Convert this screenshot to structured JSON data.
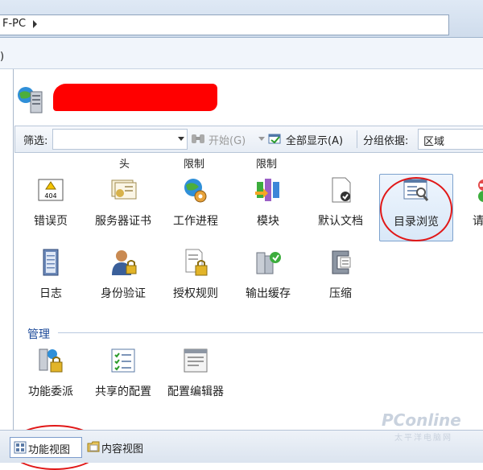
{
  "address_bar": {
    "path_text": "F-PC"
  },
  "menu": {
    "partial_text": ")"
  },
  "filter_toolbar": {
    "filter_label": "筛选:",
    "start_label": "开始(G)",
    "show_all_label": "全部显示(A)",
    "group_by_label": "分组依据:",
    "group_by_value": "区域"
  },
  "column_headers": [
    "头",
    "限制",
    "限制"
  ],
  "features_row1": [
    {
      "label": "错误页",
      "icon": "error-404-icon"
    },
    {
      "label": "服务器证书",
      "icon": "certificate-icon"
    },
    {
      "label": "工作进程",
      "icon": "worker-process-icon"
    },
    {
      "label": "模块",
      "icon": "modules-icon"
    },
    {
      "label": "默认文档",
      "icon": "default-document-icon"
    },
    {
      "label": "目录浏览",
      "icon": "directory-browsing-icon"
    },
    {
      "label": "请求",
      "icon": "request-filtering-icon"
    }
  ],
  "features_row2": [
    {
      "label": "日志",
      "icon": "logging-icon"
    },
    {
      "label": "身份验证",
      "icon": "authentication-icon"
    },
    {
      "label": "授权规则",
      "icon": "authorization-icon"
    },
    {
      "label": "输出缓存",
      "icon": "output-cache-icon"
    },
    {
      "label": "压缩",
      "icon": "compression-icon"
    }
  ],
  "management_group": {
    "title": "管理",
    "items": [
      {
        "label": "功能委派",
        "icon": "feature-delegation-icon"
      },
      {
        "label": "共享的配置",
        "icon": "shared-config-icon"
      },
      {
        "label": "配置编辑器",
        "icon": "config-editor-icon"
      }
    ]
  },
  "view_tabs": [
    {
      "label": "功能视图",
      "active": true
    },
    {
      "label": "内容视图",
      "active": false
    }
  ],
  "watermark": {
    "brand": "PConline",
    "sub": "太平洋电脑网"
  },
  "colors": {
    "annotation_red": "#e11818",
    "selection_blue": "#7da2ce",
    "group_title": "#1e4b9a"
  }
}
